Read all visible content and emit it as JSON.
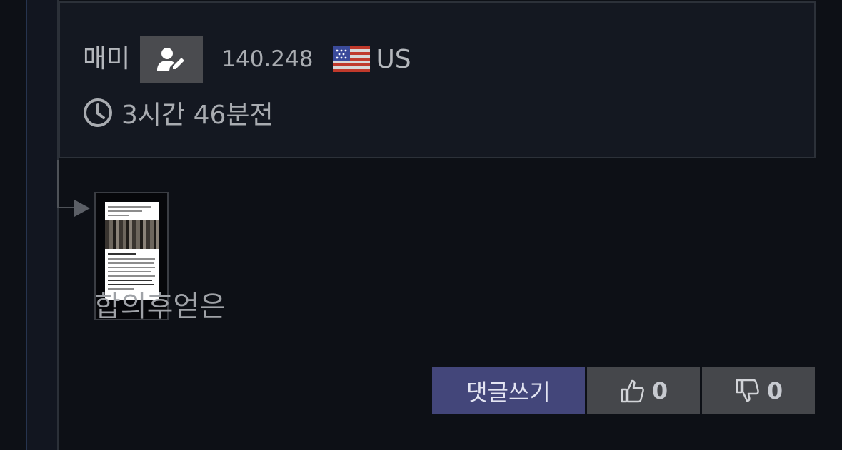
{
  "author": {
    "name": "매미",
    "ip": "140.248",
    "country_code": "US",
    "flag": "us-flag-icon",
    "member_icon": "user-edit-icon"
  },
  "post": {
    "time_ago": "3시간 46분전",
    "text": "합의후얻은",
    "attachment_icon": "image-thumbnail"
  },
  "actions": {
    "reply_label": "댓글쓰기",
    "upvote_count": "0",
    "downvote_count": "0"
  },
  "colors": {
    "reply_button": "#43467a",
    "vote_button": "#45474b",
    "background": "#0d1016"
  }
}
